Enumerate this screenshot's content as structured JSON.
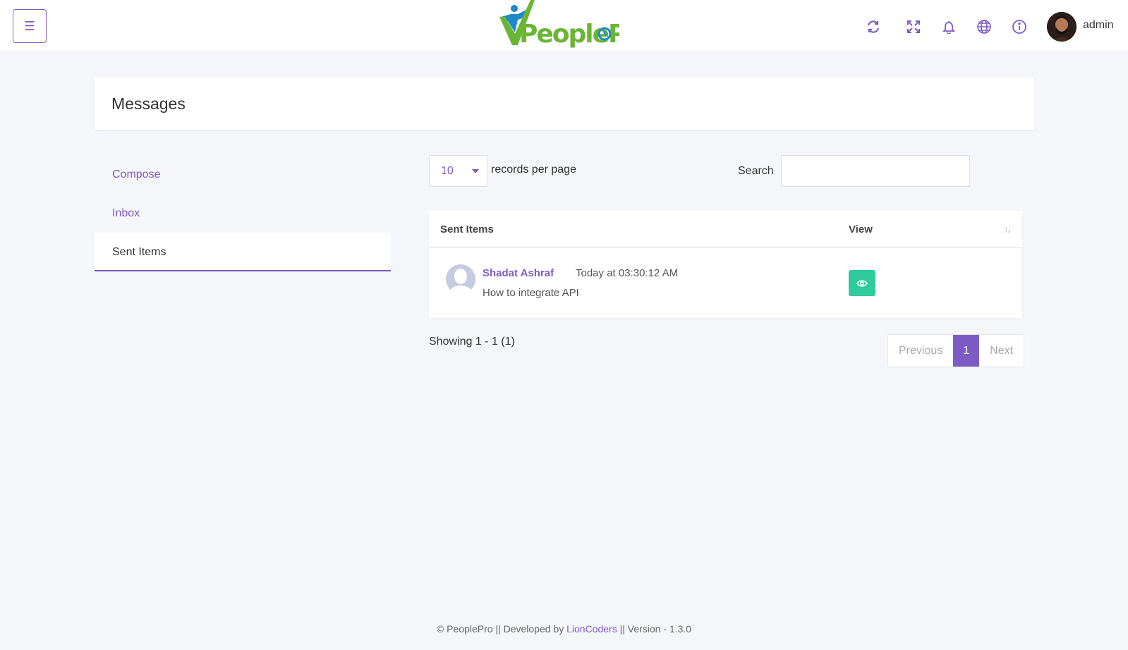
{
  "header": {
    "menu_icon": "menu-icon",
    "logo_text": "PeoplePro",
    "icons": [
      "refresh-icon",
      "fullscreen-icon",
      "bell-icon",
      "globe-icon",
      "info-icon"
    ],
    "user_name": "admin",
    "accent": "#7c5cc4"
  },
  "page": {
    "title": "Messages"
  },
  "sidebar": {
    "items": [
      {
        "label": "Compose"
      },
      {
        "label": "Inbox"
      },
      {
        "label": "Sent Items"
      }
    ]
  },
  "controls": {
    "per_page_value": "10",
    "per_page_label": "records per page",
    "search_label": "Search",
    "search_value": ""
  },
  "table": {
    "columns": [
      "Sent Items",
      "View"
    ],
    "rows": [
      {
        "sender": "Shadat Ashraf",
        "time": "Today at 03:30:12 AM",
        "subject": "How to integrate API",
        "view_icon": "eye-icon"
      }
    ]
  },
  "pagination": {
    "showing": "Showing 1 - 1 (1)",
    "previous": "Previous",
    "current": "1",
    "next": "Next"
  },
  "footer": {
    "prefix": "© PeoplePro || Developed by",
    "link": "LionCoders",
    "suffix": "|| Version - 1.3.0"
  }
}
